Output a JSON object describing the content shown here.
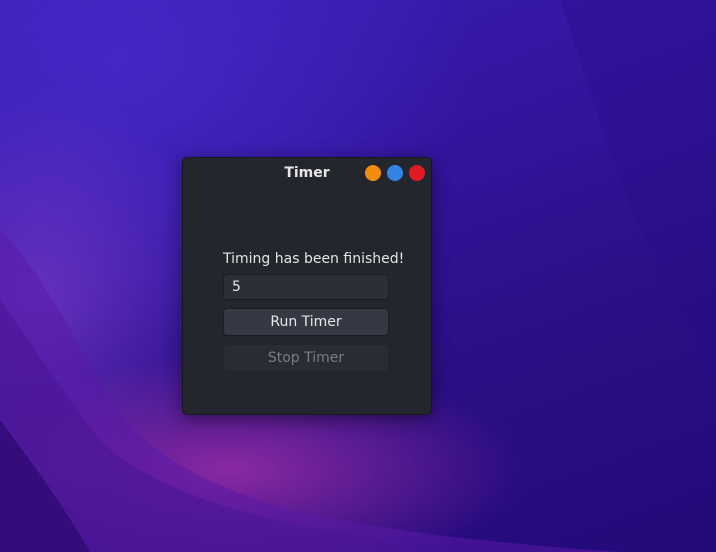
{
  "window": {
    "title": "Timer",
    "controls": [
      {
        "name": "minimize",
        "color": "#f28c0f"
      },
      {
        "name": "maximize",
        "color": "#3584e4"
      },
      {
        "name": "close",
        "color": "#e01b24"
      }
    ]
  },
  "timer": {
    "status_text": "Timing has been finished!",
    "input_value": "5",
    "run_label": "Run Timer",
    "stop_label": "Stop Timer",
    "stop_enabled": false
  },
  "colors": {
    "window_bg": "#24262d",
    "button_bg": "#363944",
    "text": "#e6e6e6",
    "disabled_text": "#7a7c82"
  }
}
